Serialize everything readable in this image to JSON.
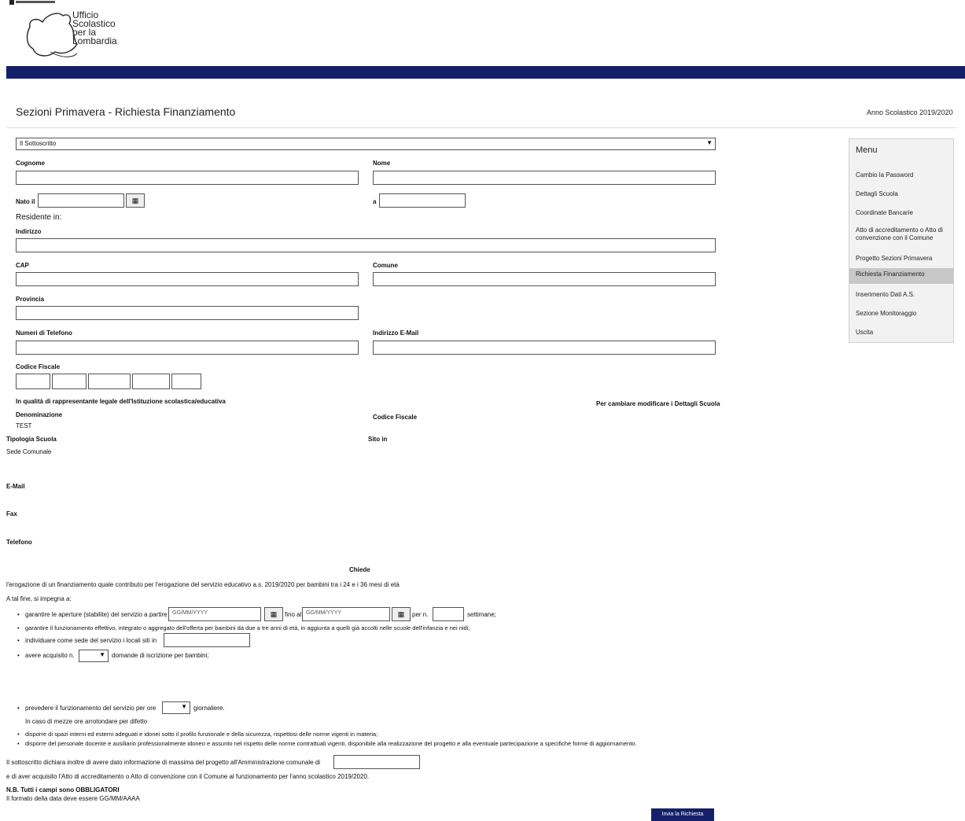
{
  "header": {
    "logo_line1": "Ufficio",
    "logo_line2": "Scolastico",
    "logo_line3": "per la",
    "logo_line4": "Lombardia",
    "page_title": "Sezioni Primavera - Richiesta Finanziamento",
    "school_year": "Anno Scolastico 2019/2020"
  },
  "form": {
    "title_select": "Il Sottoscritto",
    "cognome_label": "Cognome",
    "nome_label": "Nome",
    "nato_label": "Nato il",
    "a_label": "a",
    "residente_label": "Residente in:",
    "indirizzo_label": "Indirizzo",
    "cap_label": "CAP",
    "comune_label": "Comune",
    "provincia_label": "Provincia",
    "telefono_label": "Numeri di Telefono",
    "email_label": "Indirizzo E-Mail",
    "cf_label": "Codice Fiscale",
    "qualita_text": "In qualità di rappresentante legale dell'Istituzione scolastica/educativa",
    "cambiare_text": "Per cambiare modificare i Dettagli Scuola",
    "denominazione_label": "Denominazione",
    "denominazione_value": "TEST",
    "cf_scuola_label": "Codice Fiscale",
    "tipologia_label": "Tipologia Scuola",
    "sito_label": "Sito in",
    "comune_sede_label": "Sede Comunale",
    "email2_label": "E-Mail",
    "fax_label": "Fax",
    "telefono2_label": "Telefono",
    "chiede": "Chiede",
    "erogazione_text": "l'erogazione di un finanziamento quale contributo per l'erogazione del servizio educativo a.s. 2019/2020 per bambini tra i 24 e i 36 mesi di età",
    "impegno_text": "A tal fine, si impegna a:",
    "b1_text": "garantire le aperture (stabilite) del servizio a partire dal",
    "date_placeholder": "GG/MM/YYYY",
    "fino_al": "fino al",
    "per_n": "per n.",
    "settimane": "settimane;",
    "b2_text": "garantire il funzionamento effettivo, integrato o aggregato dell'offerta per bambini da due a tre anni di età, in aggiunta a quelli già accolti nelle scuole dell'infanzia e nei nidi;",
    "b3_text": "individuare come sede del servizio i locali siti in",
    "b4_text": "avere acquisito n.",
    "b4_text2": "domande di iscrizione per bambini;",
    "b5_text": "prevedere il funzionamento del servizio per ore",
    "b5_text2": "giornaliere.",
    "note_text": "In caso di mezze ore arrotondare per difetto",
    "b6_text": "disporre di spazi interni ed esterni adeguati e idonei sotto il profilo funzionale e della sicurezza, rispettosi delle norme vigenti in materia;",
    "b7_text": "disporre del personale docente e ausiliario professionalmente idoneo e assunto nel rispetto delle norme contrattuali vigenti, disponibile alla realizzazione del progetto e alla eventuale partecipazione a specifiche forme di aggiornamento.",
    "dichiara_text": "Il sottoscritto dichiara inoltre di avere dato informazione di massima del progetto all'Amministrazione comunale di",
    "acquisito_text": "e di aver acquisito l'Atto di accreditamento o Atto di convenzione con il Comune al funzionamento per l'anno scolastico 2019/2020.",
    "nb_text": "N.B. Tutti i campi sono OBBLIGATORI",
    "formato_text": "Il formato della data deve essere GG/MM/AAAA",
    "submit_label": "Invia la Richiesta"
  },
  "menu": {
    "title": "Menu",
    "items": [
      "Cambio la Password",
      "Dettagli Scuola",
      "Coordinate Bancarie",
      "Atto di accreditamento o Atto di convenzione con il Comune",
      "Progetto Sezioni Primavera",
      "Richiesta Finanziamento",
      "Inserimento Dati A.S.",
      "Sezione Monitoraggio",
      "Uscita"
    ]
  }
}
